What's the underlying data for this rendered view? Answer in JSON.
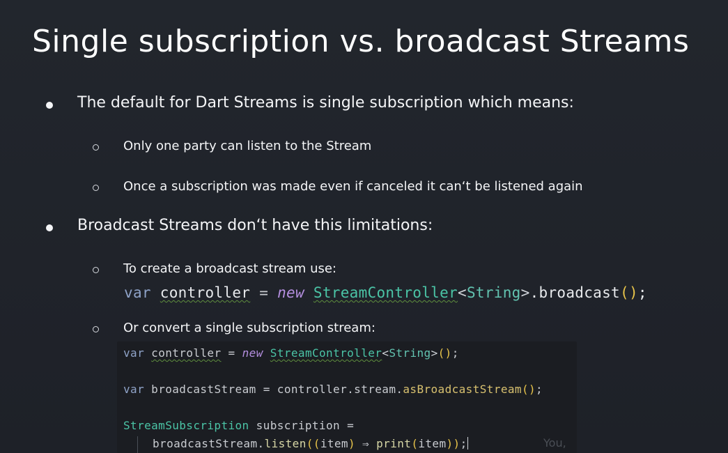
{
  "slide": {
    "title": "Single subscription vs. broadcast Streams",
    "bullets": [
      {
        "text": "The default for Dart Streams is single subscription which means:",
        "subitems": [
          "Only one party can listen to the Stream",
          "Once a subscription was made even if canceled it can‘t be listened again"
        ]
      },
      {
        "text": "Broadcast Streams don‘t have this limitations:",
        "subitems": [
          "To create a broadcast stream use:",
          "Or convert a single subscription stream:"
        ]
      }
    ],
    "code_broadcast": {
      "kw": "var",
      "ident": "controller",
      "eq": "=",
      "new_kw": "new",
      "type": "StreamController",
      "lt": "<",
      "generic": "String",
      "gt": ">",
      "dot_method": ".broadcast",
      "paren": "()",
      "semi": ";"
    },
    "code_convert": {
      "line1": {
        "kw": "var",
        "ident": "controller",
        "eq": "=",
        "new_kw": "new",
        "type": "StreamController",
        "lt": "<",
        "generic": "String",
        "gt": ">",
        "paren": "()",
        "semi": ";"
      },
      "line2": {
        "kw": "var",
        "ident": "broadcastStream",
        "eq": "=",
        "chain": "controller.stream.",
        "method": "asBroadcastStream",
        "paren": "()",
        "semi": ";"
      },
      "line3": {
        "type": "StreamSubscription",
        "ident": "subscription",
        "eq": "="
      },
      "line4": {
        "obj": "broadcastStream.",
        "method": "listen",
        "open": "((",
        "param": "item",
        "close_param": ")",
        "arrow": "⇒",
        "call": "print",
        "call_open": "(",
        "arg": "item",
        "close": "))",
        "semi": ";"
      },
      "ghost_text": "You,"
    }
  }
}
